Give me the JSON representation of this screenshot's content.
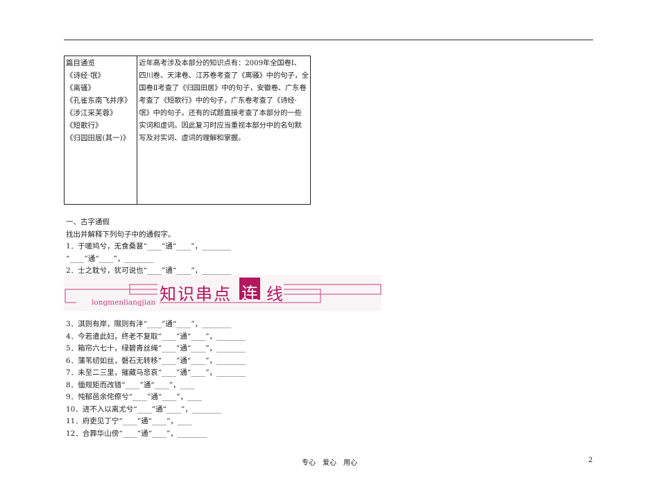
{
  "table": {
    "left": [
      "篇目通览",
      "《诗经·氓》",
      "《离骚》",
      "《孔雀东南飞并序》",
      "《涉江采芙蓉》",
      "《短歌行》",
      "《归园田居(其一)》"
    ],
    "right": [
      "近年高考涉及本部分的知识点有：2009年全国卷Ⅰ、",
      "四川卷、天津卷、江苏卷考查了《离骚》中的句子，全",
      "国卷Ⅱ考查了《归园田居》中的句子，安徽卷、广东卷",
      "考查了《短歌行》中的句子，广东卷考查了《诗经·",
      "氓》中的句子。还有的试题直接考查了本部分的一些",
      "实词和虚词。因此复习时应当重视本部分中的名句默",
      "写及对实词、虚词的理解和掌握。"
    ]
  },
  "section": {
    "title": "一、古字通假",
    "instruction": "找出并解释下列句子中的通假字。",
    "items_before": [
      "1．于嗟鸠兮，无食桑葚“____”通“____”，________",
      "“____”通“____”，________",
      "2．士之耽兮，犹可说也“____”通“____”，________"
    ],
    "items_after": [
      "3．淇则有岸，隰则有泮“____”通“____”，________",
      "4．今若遣此妇，终老不复取“____”通“____”，________",
      "5．箱帘六七十，绿碧青丝绳“____”通“____”，________",
      "6．蒲苇纫如丝，磐石无转移“____”通“____”，________",
      "7．未至二三里，摧藏马悲哀“____”通“____”，________",
      "8．偭规矩而改错“____”通“____”，____",
      "9．忳郁邑余侘傺兮“____”通“____”，____",
      "10．进不入以离尤兮“____”通“____”，________",
      "11．府吏见丁宁“____”通“____”，____",
      "12．合葬华山傍“____”通“____”，________"
    ]
  },
  "banner": {
    "title_a": "知识串点",
    "title_box": "连",
    "title_b": "线",
    "subtitle": "longmenliangjian",
    "color": "#b5175f"
  },
  "footer": {
    "text": "专心　爱心　用心",
    "page": "2"
  }
}
